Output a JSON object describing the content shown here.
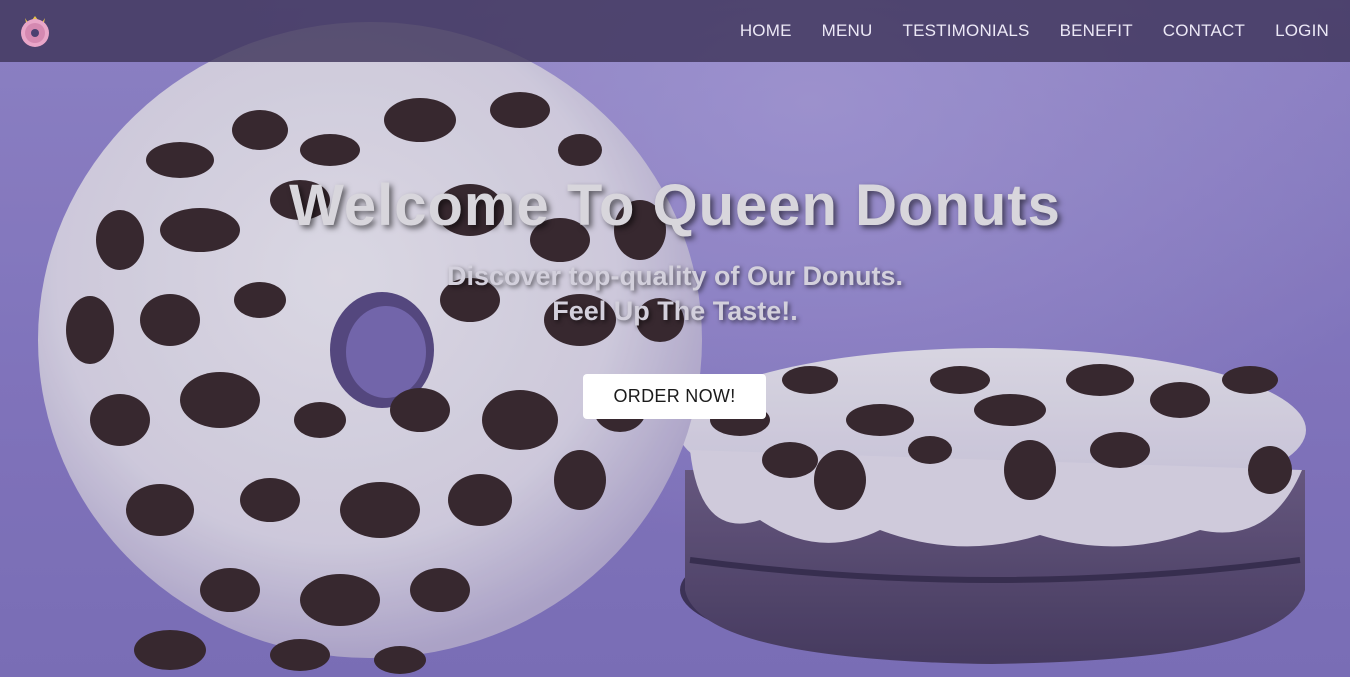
{
  "brand": {
    "logo_icon": "donut-crown-logo-icon",
    "colors": {
      "logo_pink": "#e9a6c8",
      "crown_gold": "#e8c24a",
      "nav_bg": "#3e345a"
    }
  },
  "nav": {
    "items": [
      {
        "label": "HOME"
      },
      {
        "label": "MENU"
      },
      {
        "label": "TESTIMONIALS"
      },
      {
        "label": "BENEFIT"
      },
      {
        "label": "CONTACT"
      },
      {
        "label": "LOGIN"
      }
    ]
  },
  "hero": {
    "title": "Welcome To Queen Donuts",
    "tagline_line1": "Discover top-quality of Our Donuts.",
    "tagline_line2": "Feel Up The Taste!.",
    "cta_label": "ORDER NOW!",
    "background": "oreo-donuts-photo",
    "colors": {
      "bg": "#8d80c8",
      "frosting": "#e9e6f2",
      "cookie": "#3a2a2c"
    }
  }
}
